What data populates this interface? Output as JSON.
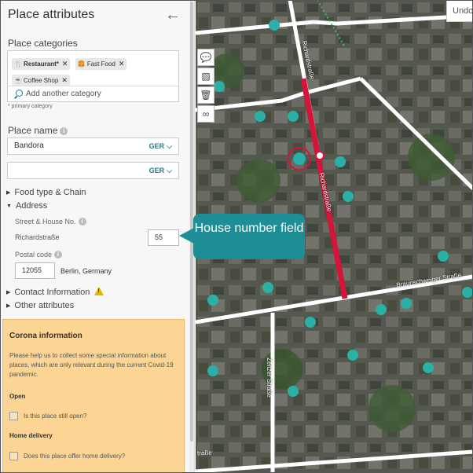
{
  "panel": {
    "title": "Place attributes",
    "categories": {
      "label": "Place categories",
      "chips": [
        {
          "icon": "🍴",
          "label": "Restaurant*",
          "primary": true
        },
        {
          "icon": "🍔",
          "label": "Fast Food",
          "primary": false
        },
        {
          "icon": "☕",
          "label": "Coffee Shop",
          "primary": false
        }
      ],
      "add_placeholder": "Add another category",
      "primary_note": "* primary category"
    },
    "place_name": {
      "label": "Place name",
      "value": "Bandora",
      "language": "GER",
      "second_value": "",
      "second_language": "GER"
    },
    "sections": {
      "food_type": "Food type & Chain",
      "address": "Address",
      "contact": "Contact Information",
      "other": "Other attributes"
    },
    "address": {
      "street_label": "Street & House No.",
      "street_value": "Richardstraße",
      "house_number": "55",
      "postal_label": "Postal code",
      "postal_value": "12055",
      "city": "Berlin, Germany"
    },
    "corona": {
      "title": "Corona information",
      "text": "Please help us to collect some special information about places, which are only relevant during the current Covid-19 pandemic.",
      "open_heading": "Open",
      "open_question": "Is this place still open?",
      "delivery_heading": "Home delivery",
      "delivery_question": "Does this place offer home delivery?"
    }
  },
  "map": {
    "undo_label": "Undo",
    "callout": "House number field",
    "roads": {
      "richard_1": "Richardstraße",
      "richard_2": "Richardstraße",
      "braunschweiger": "Braunschweiger Straße",
      "zeitzer": "Zeitzer Straße",
      "bottom": "traße"
    },
    "tool_icons": [
      "comment-icon",
      "image-icon",
      "trash-icon",
      "binoculars-icon"
    ],
    "colors": {
      "selected_road": "#d5143a",
      "poi_marker": "#2ab0a6",
      "callout": "#1d8e96",
      "corona_panel": "#fcd594"
    }
  }
}
